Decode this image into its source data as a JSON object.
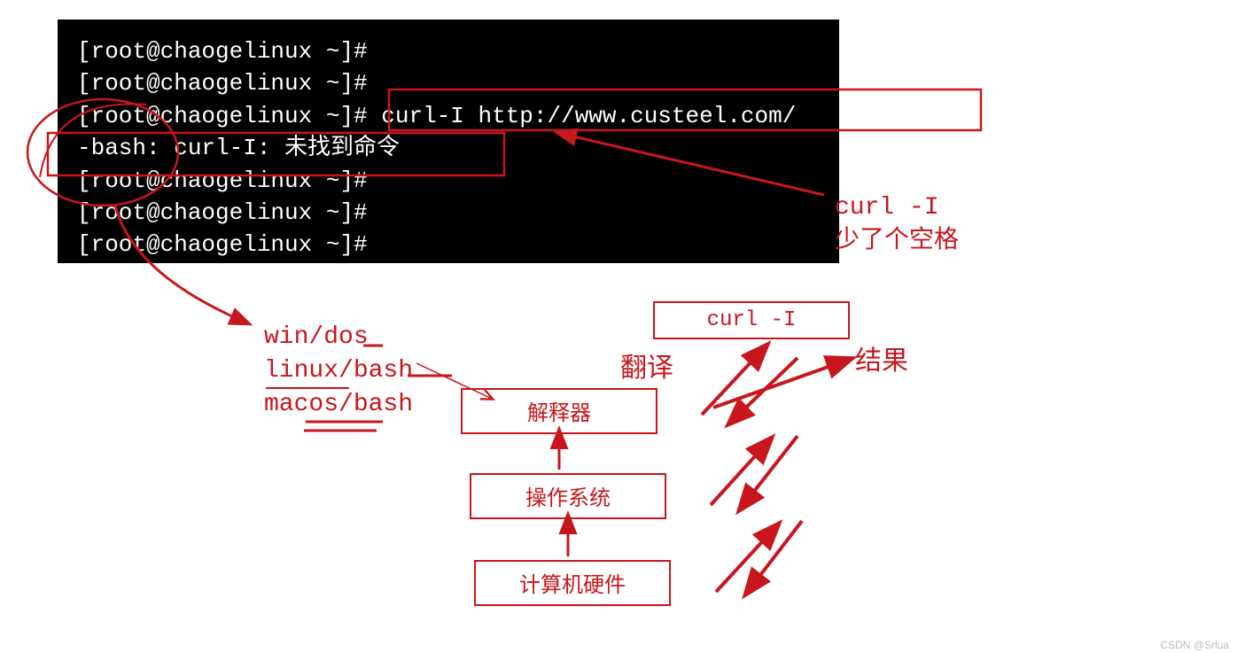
{
  "terminal": {
    "lines": [
      "[root@chaogelinux ~]#",
      "[root@chaogelinux ~]#",
      "[root@chaogelinux ~]# curl-I http://www.custeel.com/",
      "-bash: curl-I: 未找到命令",
      "[root@chaogelinux ~]#",
      "[root@chaogelinux ~]#",
      "[root@chaogelinux ~]#"
    ]
  },
  "annotation_right": {
    "line1": "curl -I",
    "line2": "少了个空格"
  },
  "os_list": {
    "items": [
      "win/dos",
      "linux/bash",
      "macos/bash"
    ]
  },
  "diagram": {
    "box_curl": "curl -I",
    "box_interpreter": "解释器",
    "box_os": "操作系统",
    "box_hw": "计算机硬件",
    "label_translate": "翻译",
    "label_result": "结果"
  },
  "watermark": "CSDN @Srlua"
}
